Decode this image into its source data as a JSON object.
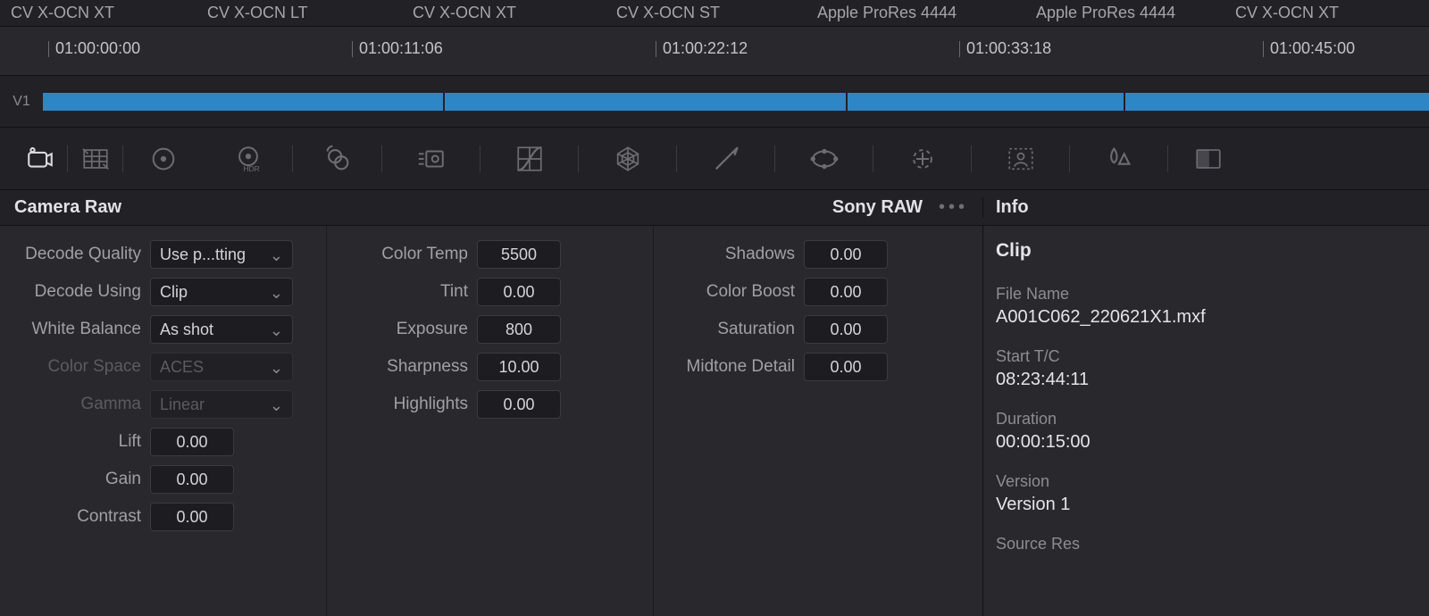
{
  "codecs": {
    "c0": "CV X-OCN XT",
    "c1": "CV X-OCN LT",
    "c2": "CV X-OCN XT",
    "c3": "CV X-OCN ST",
    "c4": "Apple ProRes 4444",
    "c5": "Apple ProRes 4444",
    "c6": "CV X-OCN XT"
  },
  "ruler": {
    "t0": "01:00:00:00",
    "t1": "01:00:11:06",
    "t2": "01:00:22:12",
    "t3": "01:00:33:18",
    "t4": "01:00:45:00"
  },
  "track": {
    "label": "V1"
  },
  "headers": {
    "camera_raw": "Camera Raw",
    "codec": "Sony RAW",
    "info": "Info"
  },
  "col1": {
    "decode_quality": {
      "label": "Decode Quality",
      "value": "Use p...tting"
    },
    "decode_using": {
      "label": "Decode Using",
      "value": "Clip"
    },
    "white_balance": {
      "label": "White Balance",
      "value": "As shot"
    },
    "color_space": {
      "label": "Color Space",
      "value": "ACES"
    },
    "gamma": {
      "label": "Gamma",
      "value": "Linear"
    },
    "lift": {
      "label": "Lift",
      "value": "0.00"
    },
    "gain": {
      "label": "Gain",
      "value": "0.00"
    },
    "contrast": {
      "label": "Contrast",
      "value": "0.00"
    }
  },
  "col2": {
    "color_temp": {
      "label": "Color Temp",
      "value": "5500"
    },
    "tint": {
      "label": "Tint",
      "value": "0.00"
    },
    "exposure": {
      "label": "Exposure",
      "value": "800"
    },
    "sharpness": {
      "label": "Sharpness",
      "value": "10.00"
    },
    "highlights": {
      "label": "Highlights",
      "value": "0.00"
    }
  },
  "col3": {
    "shadows": {
      "label": "Shadows",
      "value": "0.00"
    },
    "color_boost": {
      "label": "Color Boost",
      "value": "0.00"
    },
    "saturation": {
      "label": "Saturation",
      "value": "0.00"
    },
    "midtone_detail": {
      "label": "Midtone Detail",
      "value": "0.00"
    }
  },
  "info": {
    "clip_title": "Clip",
    "file_name": {
      "k": "File Name",
      "v": "A001C062_220621X1.mxf"
    },
    "start_tc": {
      "k": "Start T/C",
      "v": "08:23:44:11"
    },
    "duration": {
      "k": "Duration",
      "v": "00:00:15:00"
    },
    "version": {
      "k": "Version",
      "v": "Version 1"
    },
    "source_res": {
      "k": "Source Res"
    }
  }
}
